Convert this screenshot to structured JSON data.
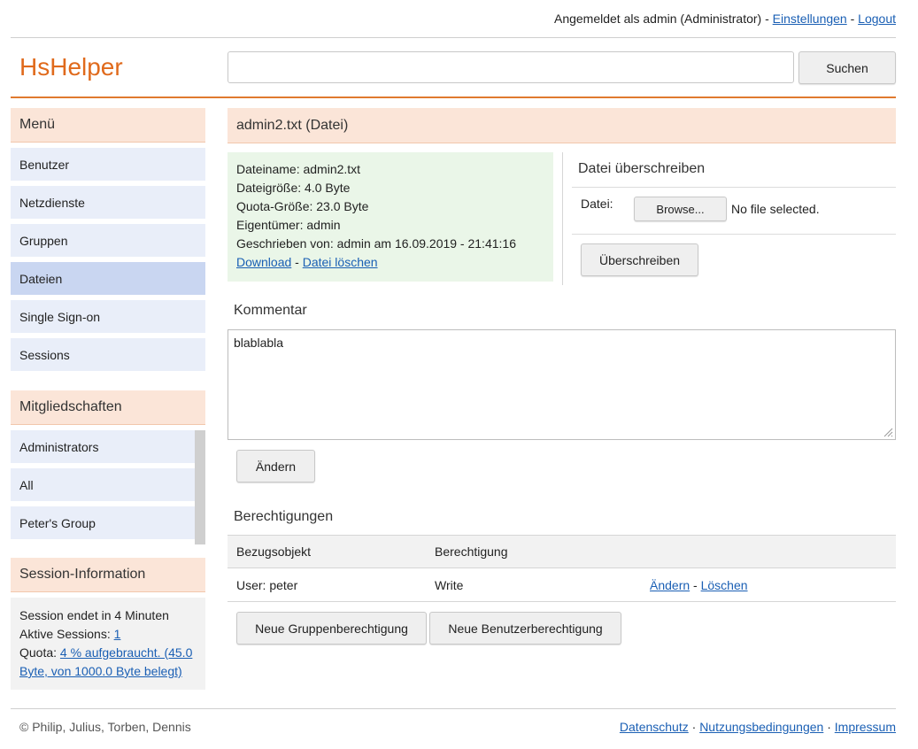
{
  "topbar": {
    "logged_in_text": "Angemeldet als admin (Administrator)",
    "sep1": " - ",
    "settings_link": "Einstellungen",
    "sep2": " - ",
    "logout_link": "Logout"
  },
  "header": {
    "logo": "HsHelper",
    "search_value": "",
    "search_button": "Suchen"
  },
  "sidebar": {
    "menu_title": "Menü",
    "menu_items": [
      {
        "label": "Benutzer"
      },
      {
        "label": "Netzdienste"
      },
      {
        "label": "Gruppen"
      },
      {
        "label": "Dateien",
        "active": true
      },
      {
        "label": "Single Sign-on"
      },
      {
        "label": "Sessions"
      }
    ],
    "memberships_title": "Mitgliedschaften",
    "memberships": [
      {
        "label": "Administrators"
      },
      {
        "label": "All"
      },
      {
        "label": "Peter's Group"
      }
    ],
    "session_title": "Session-Information",
    "session_ends": "Session endet in 4 Minuten",
    "active_sessions_label": "Aktive Sessions: ",
    "active_sessions_value": "1",
    "quota_label": "Quota: ",
    "quota_link": "4 % aufgebraucht. (45.0 Byte, von 1000.0 Byte belegt)"
  },
  "main": {
    "title": "admin2.txt (Datei)",
    "info": {
      "filename": "Dateiname: admin2.txt",
      "filesize": "Dateigröße: 4.0 Byte",
      "quota_size": "Quota-Größe: 23.0 Byte",
      "owner": "Eigentümer: admin",
      "written_by": "Geschrieben von: admin am 16.09.2019 - 21:41:16",
      "download_link": "Download",
      "link_sep": " - ",
      "delete_link": "Datei löschen"
    },
    "overwrite": {
      "title": "Datei überschreiben",
      "file_label": "Datei:",
      "browse_button": "Browse...",
      "no_file": "No file selected.",
      "submit_button": "Überschreiben"
    },
    "comment": {
      "title": "Kommentar",
      "value": "blablabla",
      "change_button": "Ändern"
    },
    "permissions": {
      "title": "Berechtigungen",
      "headers": [
        "Bezugsobjekt",
        "Berechtigung",
        ""
      ],
      "rows": [
        {
          "subject": "User: peter",
          "permission": "Write",
          "edit_link": "Ändern",
          "sep": " - ",
          "delete_link": "Löschen"
        }
      ],
      "new_group_button": "Neue Gruppenberechtigung",
      "new_user_button": "Neue Benutzerberechtigung"
    }
  },
  "footer": {
    "copyright": "© Philip, Julius, Torben, Dennis",
    "privacy_link": "Datenschutz",
    "dot1": " · ",
    "terms_link": "Nutzungsbedingungen",
    "dot2": " · ",
    "imprint_link": "Impressum"
  },
  "colors": {
    "accent": "#e06a1c",
    "section_header_bg": "#fbe5d8",
    "nav_item_bg": "#e9eef9",
    "nav_item_active_bg": "#c9d6f1",
    "info_box_bg": "#eaf6e8",
    "link": "#1a5fb4"
  }
}
